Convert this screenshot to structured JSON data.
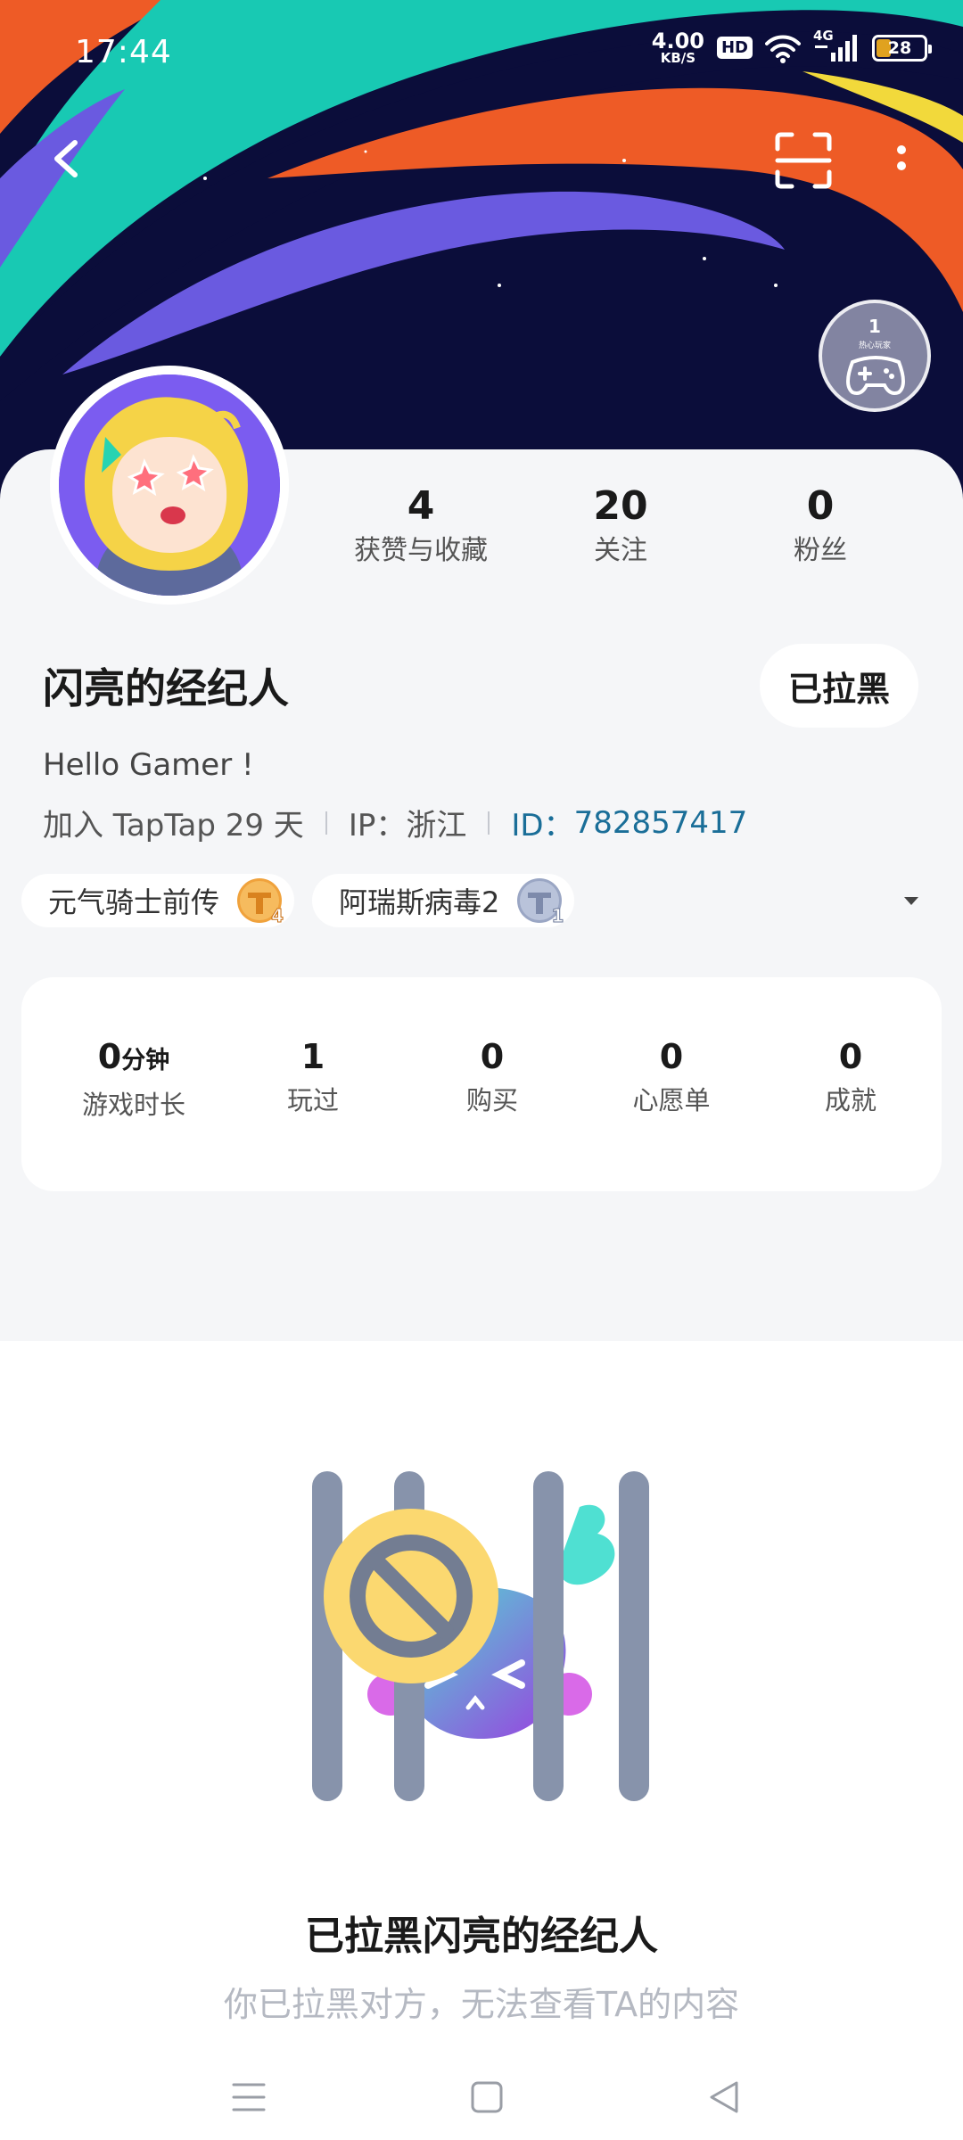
{
  "status_bar": {
    "time": "17:44",
    "net_speed_value": "4.00",
    "net_speed_unit": "KB/S",
    "hd": "HD",
    "network": "4G",
    "battery": "28"
  },
  "header": {
    "level_number": "1",
    "level_text": "热心玩家"
  },
  "profile": {
    "stats": [
      {
        "value": "4",
        "label": "获赞与收藏"
      },
      {
        "value": "20",
        "label": "关注"
      },
      {
        "value": "0",
        "label": "粉丝"
      }
    ],
    "username": "闪亮的经纪人",
    "blocked_button": "已拉黑",
    "bio": "Hello Gamer !",
    "join_text": "加入 TapTap 29 天",
    "ip_text": "IP：浙江",
    "id_label": "ID：",
    "id_value": "782857417",
    "tags": [
      {
        "name": "元气骑士前传",
        "badge_level": "4",
        "badge_color": "#f0a23c"
      },
      {
        "name": "阿瑞斯病毒2",
        "badge_level": "1",
        "badge_color": "#9aa6c4"
      }
    ]
  },
  "game_stats": [
    {
      "value": "0",
      "unit": "分钟",
      "label": "游戏时长"
    },
    {
      "value": "1",
      "unit": "",
      "label": "玩过"
    },
    {
      "value": "0",
      "unit": "",
      "label": "购买"
    },
    {
      "value": "0",
      "unit": "",
      "label": "心愿单"
    },
    {
      "value": "0",
      "unit": "",
      "label": "成就"
    }
  ],
  "blocked": {
    "title": "已拉黑闪亮的经纪人",
    "description": "你已拉黑对方，无法查看TA的内容"
  },
  "colors": {
    "banner_bg": "#0b0d3a",
    "stripe_purple": "#6a5ae0",
    "stripe_teal": "#18c9b3",
    "stripe_orange": "#ee5b26",
    "id_blue": "#1a6e98",
    "block_yellow": "#fbd870",
    "bar_gray": "#8793ab"
  },
  "icons": {
    "back": "back-arrow-icon",
    "scan": "scan-icon",
    "more": "more-vertical-icon",
    "expand": "chevron-down-icon"
  }
}
